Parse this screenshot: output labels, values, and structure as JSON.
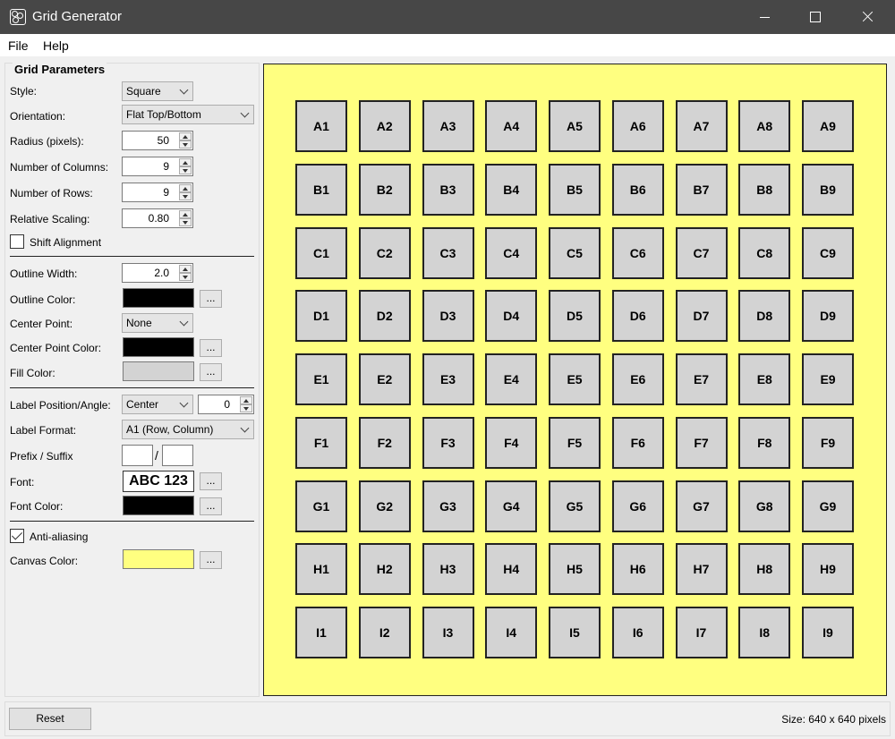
{
  "window": {
    "title": "Grid Generator"
  },
  "menu": {
    "file": "File",
    "help": "Help"
  },
  "params": {
    "group_title": "Grid Parameters",
    "style": {
      "label": "Style:",
      "value": "Square"
    },
    "orientation": {
      "label": "Orientation:",
      "value": "Flat Top/Bottom"
    },
    "radius": {
      "label": "Radius (pixels):",
      "value": "50"
    },
    "columns": {
      "label": "Number of Columns:",
      "value": "9"
    },
    "rows": {
      "label": "Number of Rows:",
      "value": "9"
    },
    "scaling": {
      "label": "Relative Scaling:",
      "value": "0.80"
    },
    "shift": {
      "label": "Shift Alignment",
      "checked": false
    },
    "outline_width": {
      "label": "Outline Width:",
      "value": "2.0"
    },
    "outline_color": {
      "label": "Outline Color:",
      "color": "#000000",
      "button": "..."
    },
    "center_point": {
      "label": "Center Point:",
      "value": "None"
    },
    "center_point_color": {
      "label": "Center Point Color:",
      "color": "#000000",
      "button": "..."
    },
    "fill_color": {
      "label": "Fill Color:",
      "color": "#d3d3d3",
      "button": "..."
    },
    "label_position": {
      "label": "Label Position/Angle:",
      "value": "Center",
      "angle": "0"
    },
    "label_format": {
      "label": "Label Format:",
      "value": "A1 (Row, Column)"
    },
    "prefix_suffix": {
      "label": "Prefix / Suffix",
      "separator": "/",
      "prefix": "",
      "suffix": ""
    },
    "font": {
      "label": "Font:",
      "sample": "ABC 123",
      "button": "..."
    },
    "font_color": {
      "label": "Font Color:",
      "color": "#000000",
      "button": "..."
    },
    "antialias": {
      "label": "Anti-aliasing",
      "checked": true
    },
    "canvas_color": {
      "label": "Canvas Color:",
      "color": "#ffff80",
      "button": "..."
    }
  },
  "grid": {
    "row_labels": [
      "A",
      "B",
      "C",
      "D",
      "E",
      "F",
      "G",
      "H",
      "I"
    ],
    "columns": 9,
    "canvas_color": "#ffff80",
    "fill_color": "#d3d3d3",
    "outline_color": "#222222"
  },
  "status": {
    "reset_label": "Reset",
    "size_text": "Size:  640 x 640 pixels"
  }
}
